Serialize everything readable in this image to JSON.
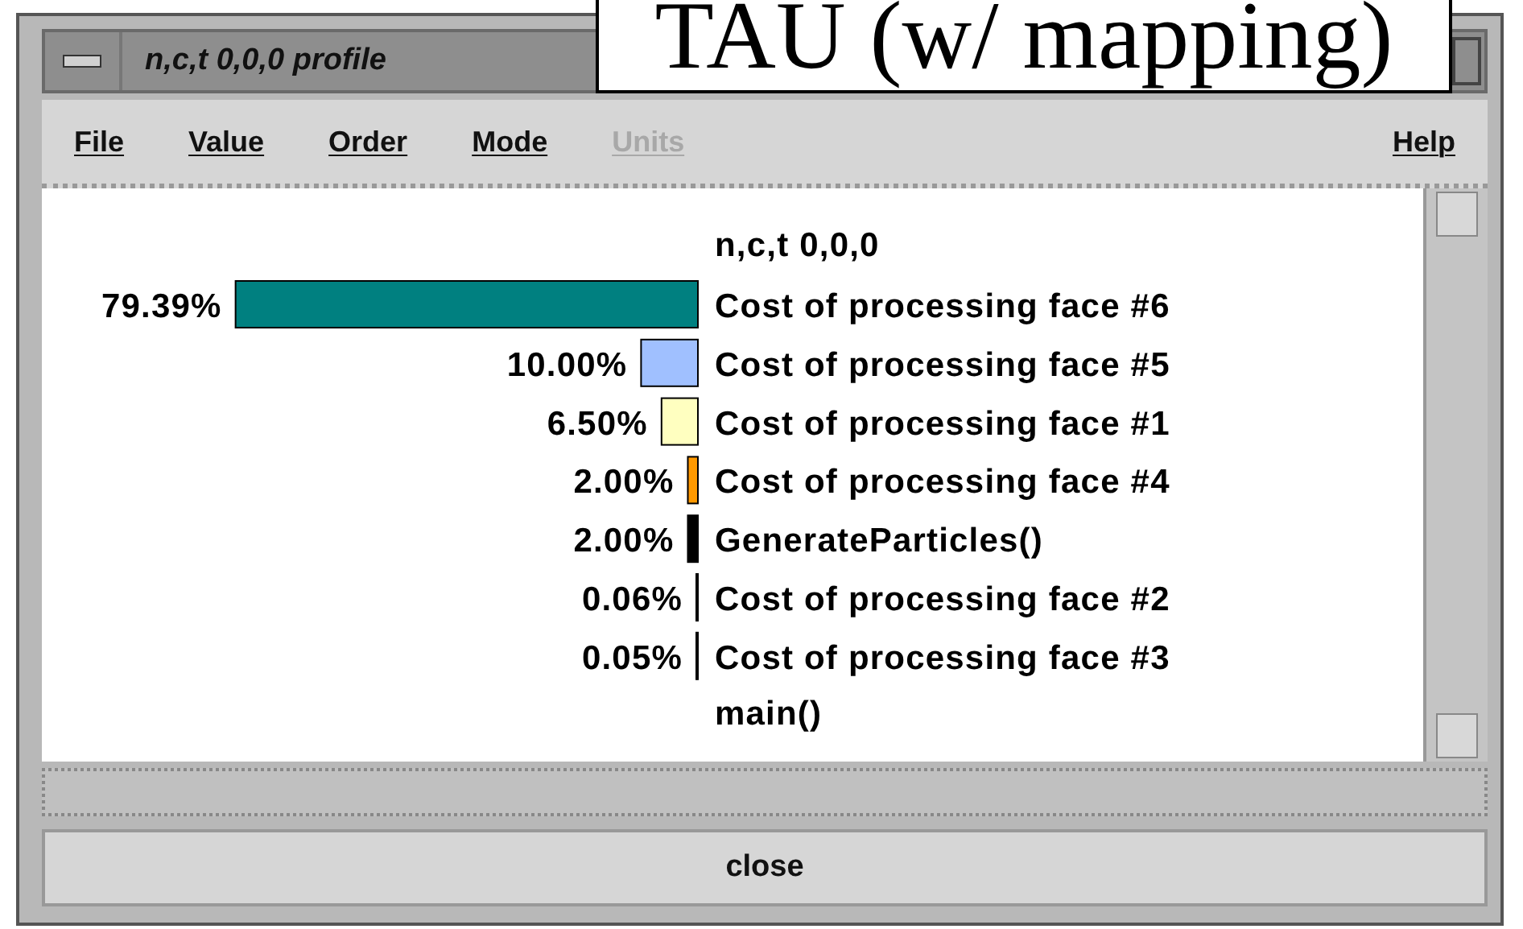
{
  "overlay_label": "TAU (w/ mapping)",
  "window": {
    "title": "n,c,t 0,0,0 profile"
  },
  "menu": [
    {
      "label": "File",
      "disabled": false
    },
    {
      "label": "Value",
      "disabled": false
    },
    {
      "label": "Order",
      "disabled": false
    },
    {
      "label": "Mode",
      "disabled": false
    },
    {
      "label": "Units",
      "disabled": true
    },
    {
      "label": "Help",
      "disabled": false
    }
  ],
  "profile": {
    "heading": "n,c,t 0,0,0",
    "chart_data": {
      "type": "bar",
      "orientation": "horizontal",
      "categories": [
        "Cost of processing face #6",
        "Cost of processing face #5",
        "Cost of processing face #1",
        "Cost of processing face #4",
        "GenerateParticles()",
        "Cost of processing face #2",
        "Cost of processing face #3"
      ],
      "values": [
        79.39,
        10.0,
        6.5,
        2.0,
        2.0,
        0.06,
        0.05
      ],
      "data_labels": true,
      "value_labels": [
        "79.39%",
        "10.00%",
        "6.50%",
        "2.00%",
        "2.00%",
        "0.06%",
        "0.05%"
      ],
      "colors": [
        "#008080",
        "#a0c0ff",
        "#ffffc0",
        "#ff9900",
        "#000000",
        "#000000",
        "#000000"
      ]
    },
    "footer": "main()"
  },
  "close_button": "close"
}
